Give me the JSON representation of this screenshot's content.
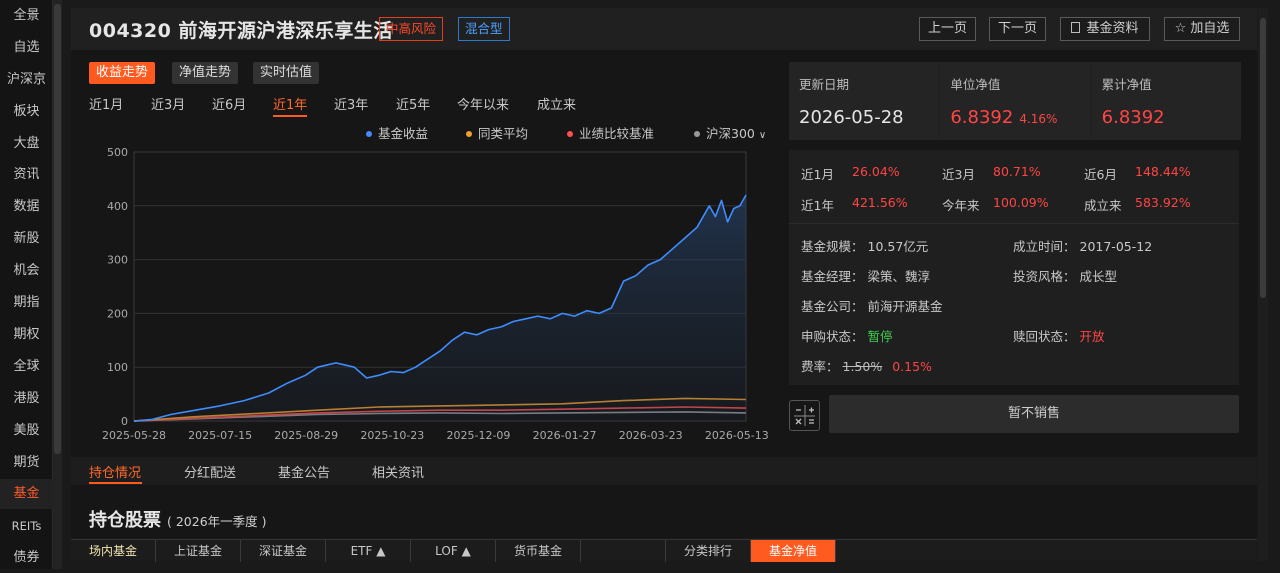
{
  "left_nav": [
    "全景",
    "自选",
    "沪深京",
    "板块",
    "大盘",
    "资讯",
    "数据",
    "新股",
    "机会",
    "期指",
    "期权",
    "全球",
    "港股",
    "美股",
    "期货",
    "基金",
    "REITs",
    "债券"
  ],
  "left_nav_active": "基金",
  "header": {
    "title": "004320  前海开源沪港深乐享生活",
    "risk_tag": "中高风险",
    "type_tag": "混合型",
    "prev_label": "上一页",
    "next_label": "下一页",
    "info_label": "基金资料",
    "watch_label": "加自选"
  },
  "chart_tabs": [
    "收益走势",
    "净值走势",
    "实时估值"
  ],
  "periods": [
    "近1月",
    "近3月",
    "近6月",
    "近1年",
    "近3年",
    "近5年",
    "今年以来",
    "成立来"
  ],
  "active_period": "近1年",
  "legend": [
    "基金收益",
    "同类平均",
    "业绩比较基准",
    "沪深300"
  ],
  "colors": {
    "fund": "#3f8cff",
    "peer": "#f0a030",
    "benchmark": "#ff5050",
    "hs300": "#9a9a9a",
    "accent": "#ff5a20",
    "up": "#ff4545",
    "green": "#3fd14e"
  },
  "chart_data": {
    "type": "area",
    "x_ticks": [
      "2025-05-28",
      "2025-07-15",
      "2025-08-29",
      "2025-10-23",
      "2025-12-09",
      "2026-01-27",
      "2026-03-23",
      "2026-05-13"
    ],
    "ylim": [
      0,
      500
    ],
    "y_ticks": [
      0,
      100,
      200,
      300,
      400,
      500
    ],
    "grid": true,
    "legend_position": "top-right",
    "series": [
      {
        "name": "基金收益",
        "x_frac": [
          0,
          0.03,
          0.06,
          0.1,
          0.14,
          0.18,
          0.22,
          0.25,
          0.28,
          0.3,
          0.33,
          0.36,
          0.38,
          0.4,
          0.42,
          0.44,
          0.46,
          0.48,
          0.5,
          0.52,
          0.54,
          0.56,
          0.58,
          0.6,
          0.62,
          0.64,
          0.66,
          0.68,
          0.7,
          0.72,
          0.74,
          0.76,
          0.78,
          0.8,
          0.82,
          0.84,
          0.86,
          0.88,
          0.9,
          0.92,
          0.94,
          0.95,
          0.96,
          0.97,
          0.98,
          0.99,
          1.0
        ],
        "values": [
          0,
          3,
          12,
          20,
          28,
          38,
          52,
          70,
          85,
          100,
          108,
          100,
          80,
          85,
          92,
          90,
          100,
          115,
          130,
          150,
          165,
          160,
          170,
          175,
          185,
          190,
          195,
          190,
          200,
          195,
          205,
          200,
          210,
          260,
          270,
          290,
          300,
          320,
          340,
          360,
          400,
          380,
          410,
          370,
          395,
          400,
          420
        ]
      },
      {
        "name": "同类平均",
        "x_frac": [
          0,
          0.1,
          0.2,
          0.3,
          0.4,
          0.5,
          0.6,
          0.7,
          0.8,
          0.9,
          1.0
        ],
        "values": [
          0,
          8,
          14,
          20,
          26,
          28,
          30,
          32,
          38,
          42,
          40
        ]
      },
      {
        "name": "业绩比较基准",
        "x_frac": [
          0,
          0.1,
          0.2,
          0.3,
          0.4,
          0.5,
          0.6,
          0.7,
          0.8,
          0.9,
          1.0
        ],
        "values": [
          0,
          5,
          10,
          15,
          18,
          20,
          20,
          22,
          24,
          26,
          24
        ]
      },
      {
        "name": "沪深300",
        "x_frac": [
          0,
          0.1,
          0.2,
          0.3,
          0.4,
          0.5,
          0.6,
          0.7,
          0.8,
          0.9,
          1.0
        ],
        "values": [
          0,
          4,
          8,
          12,
          14,
          15,
          14,
          15,
          16,
          17,
          15
        ]
      }
    ]
  },
  "summary": {
    "update_label": "更新日期",
    "update_value": "2026-05-28",
    "nav_label": "单位净值",
    "nav_value": "6.8392",
    "nav_change": "4.16%",
    "acc_label": "累计净值",
    "acc_value": "6.8392"
  },
  "performance": [
    {
      "label": "近1月",
      "value": "26.04%"
    },
    {
      "label": "近3月",
      "value": "80.71%"
    },
    {
      "label": "近6月",
      "value": "148.44%"
    },
    {
      "label": "近1年",
      "value": "421.56%"
    },
    {
      "label": "今年来",
      "value": "100.09%"
    },
    {
      "label": "成立来",
      "value": "583.92%"
    }
  ],
  "fund_info": {
    "size_label": "基金规模：",
    "size_value": "10.57亿元",
    "found_label": "成立时间：",
    "found_value": "2017-05-12",
    "manager_label": "基金经理：",
    "manager_value": "梁策、魏淳",
    "style_label": "投资风格：",
    "style_value": "成长型",
    "company_label": "基金公司：",
    "company_value": "前海开源基金",
    "buy_label": "申购状态：",
    "buy_value": "暂停",
    "redeem_label": "赎回状态：",
    "redeem_value": "开放",
    "fee_label": "费率：",
    "fee_old": "1.50%",
    "fee_new": "0.15%"
  },
  "no_sale_label": "暂不销售",
  "sub_tabs": [
    "持仓情况",
    "分红配送",
    "基金公告",
    "相关资讯"
  ],
  "section": {
    "title": "持仓股票",
    "subtitle": "( 2026年一季度 )"
  },
  "bottom_tabs": [
    "场内基金",
    "上证基金",
    "深证基金",
    "ETF ▲",
    "LOF ▲",
    "货币基金",
    "",
    "分类排行",
    "基金净值"
  ]
}
